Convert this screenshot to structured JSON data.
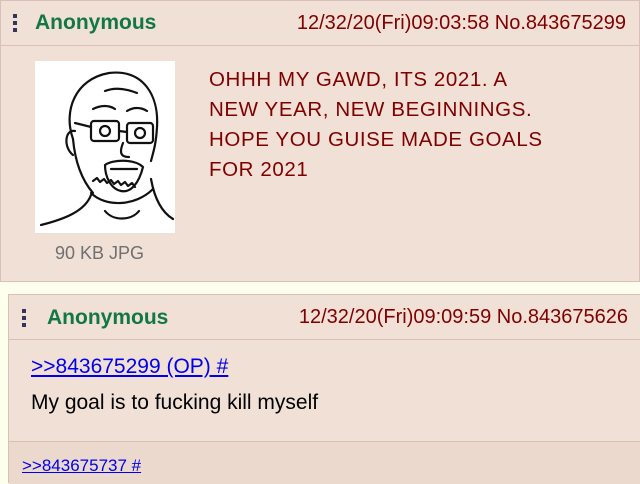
{
  "op": {
    "name": "Anonymous",
    "datetime_no": "12/32/20(Fri)09:03:58 No.843675299",
    "file_info": "90 KB JPG",
    "body_lines": [
      "OHHH MY GAWD, ITS 2021. A",
      "NEW YEAR, NEW BEGINNINGS.",
      "HOPE YOU GUISE MADE GOALS",
      "FOR 2021"
    ]
  },
  "reply": {
    "name": "Anonymous",
    "datetime_no": "12/32/20(Fri)09:09:59 No.843675626",
    "quote_link": ">>843675299 (OP) #",
    "body": "My goal is to fucking kill myself",
    "backlink": ">>843675737 #"
  },
  "colors": {
    "post_bg": "#f0e0d6",
    "name": "#117743",
    "meta": "#800000",
    "op_text": "#800000",
    "link": "#0000ee"
  },
  "icons": {
    "menu": "vertical-dots-icon"
  }
}
